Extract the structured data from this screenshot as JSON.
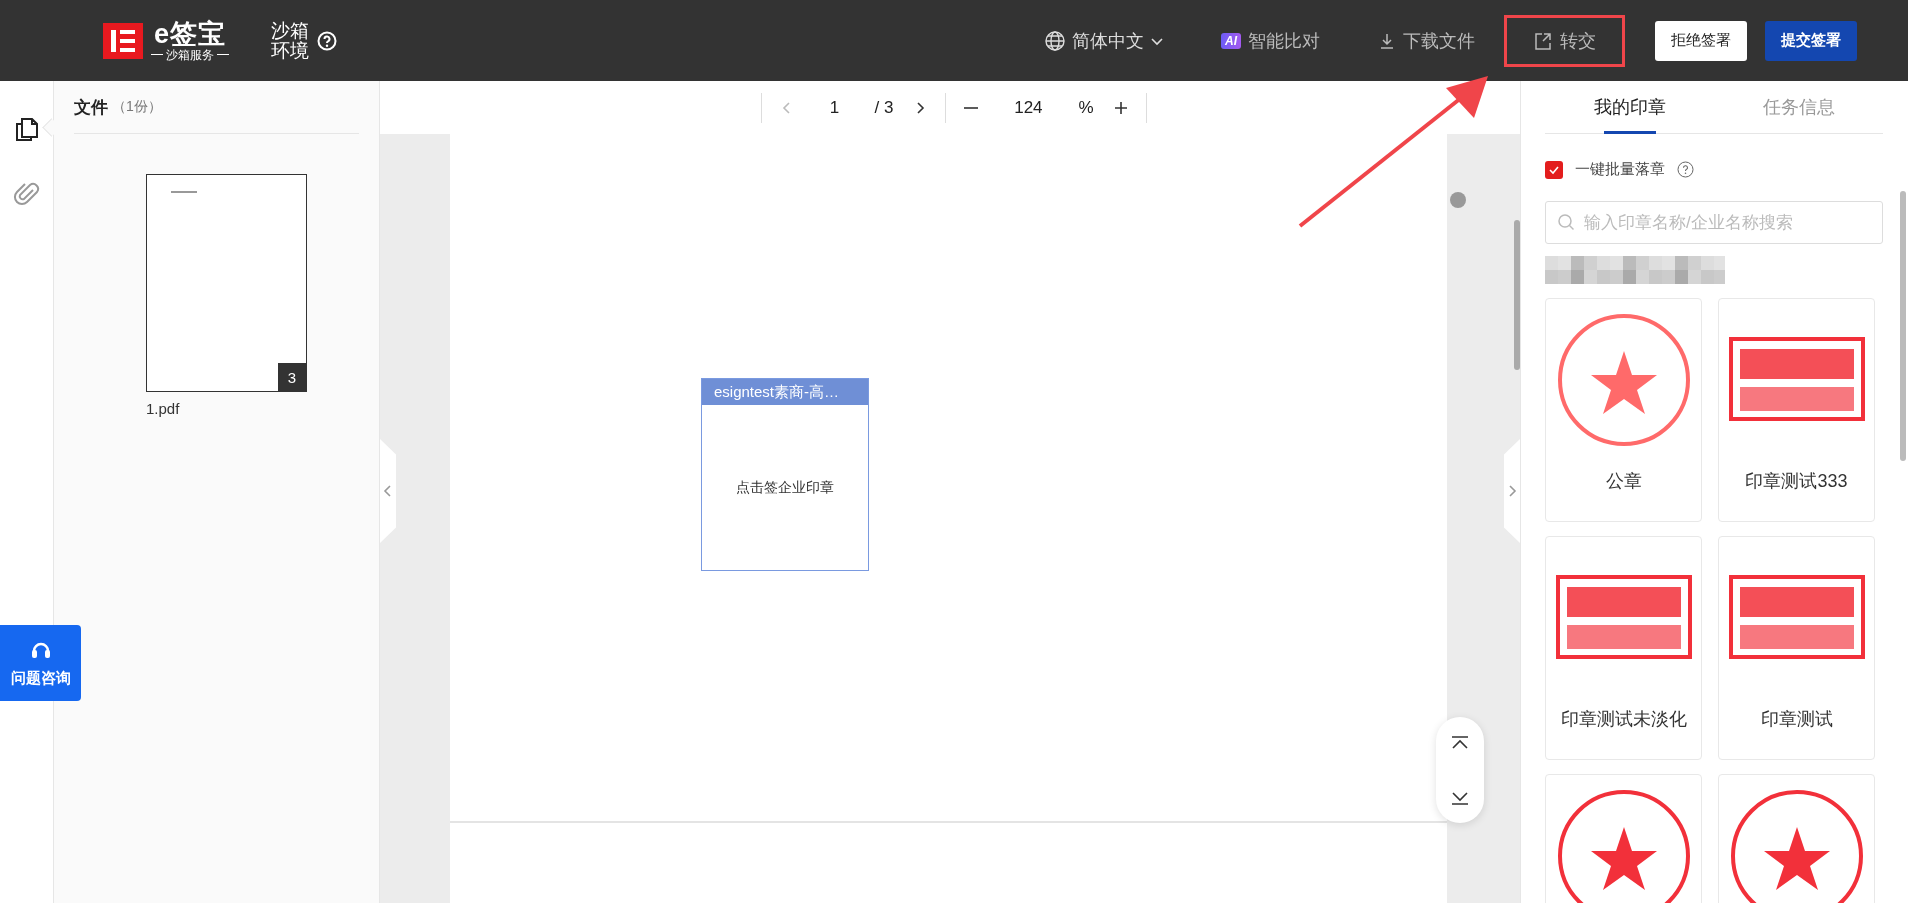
{
  "header": {
    "logo": {
      "name": "e签宝",
      "subtitle": "沙箱服务"
    },
    "environment": "沙箱环境",
    "language": "简体中文",
    "actions": [
      {
        "kind": "ai",
        "badge": "AI",
        "label": "智能比对",
        "highlighted": false
      },
      {
        "kind": "download",
        "label": "下载文件",
        "highlighted": false
      },
      {
        "kind": "transfer",
        "label": "转交",
        "highlighted": true
      }
    ],
    "buttons": [
      {
        "kind": "secondary",
        "label": "拒绝签署"
      },
      {
        "kind": "primary",
        "label": "提交签署"
      }
    ]
  },
  "rail": [
    {
      "kind": "files",
      "selected": true
    },
    {
      "kind": "attachments",
      "selected": false
    }
  ],
  "files_panel": {
    "title": "文件",
    "count": "（1份）",
    "files": [
      {
        "name": "1.pdf",
        "pages": "3"
      }
    ]
  },
  "toolbar": {
    "page": "1",
    "total": "/ 3",
    "zoom": "124",
    "zoom_unit": "%"
  },
  "signature_field": {
    "header": "esigntest素商-高…",
    "prompt": "点击签企业印章"
  },
  "right_panel": {
    "tabs": [
      {
        "label": "我的印章",
        "selected": true
      },
      {
        "label": "任务信息",
        "selected": false
      }
    ],
    "batch": {
      "label": "一键批量落章",
      "checked": true
    },
    "search": {
      "placeholder": "输入印章名称/企业名称搜索"
    },
    "seals": [
      {
        "kind": "round",
        "name": "公章",
        "faded": true
      },
      {
        "kind": "rect",
        "name": "印章测试333",
        "faded": false
      },
      {
        "kind": "rect",
        "name": "印章测试未淡化",
        "faded": false
      },
      {
        "kind": "rect",
        "name": "印章测试",
        "faded": false
      },
      {
        "kind": "round",
        "faded": false
      },
      {
        "kind": "round",
        "faded": false
      }
    ]
  },
  "help_button": {
    "label": "问题咨询"
  }
}
